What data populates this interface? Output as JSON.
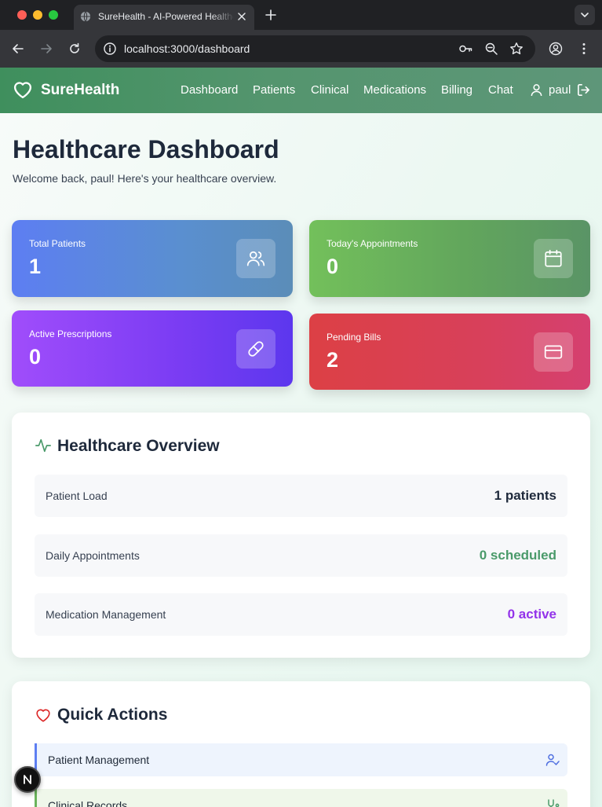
{
  "browser": {
    "tab_title": "SureHealth - AI-Powered Healthcare",
    "url": "localhost:3000/dashboard",
    "icons": [
      "globe-icon",
      "close-icon",
      "plus-icon",
      "chevron-down-icon",
      "back-icon",
      "forward-icon",
      "reload-icon",
      "site-info-icon",
      "key-icon",
      "zoom-icon",
      "star-icon",
      "profile-icon",
      "more-icon"
    ]
  },
  "header": {
    "brand": "SureHealth",
    "nav": [
      "Dashboard",
      "Patients",
      "Clinical",
      "Medications",
      "Billing",
      "Chat"
    ],
    "user": "paul"
  },
  "page": {
    "title": "Healthcare Dashboard",
    "subtitle": "Welcome back, paul! Here's your healthcare overview."
  },
  "stats": [
    {
      "label": "Total Patients",
      "value": "1",
      "icon": "users-icon",
      "color": "#5d7ef2"
    },
    {
      "label": "Today's Appointments",
      "value": "0",
      "icon": "calendar-icon",
      "color": "#6bb35c"
    },
    {
      "label": "Active Prescriptions",
      "value": "0",
      "icon": "pill-icon",
      "color": "#8b44f7"
    },
    {
      "label": "Pending Bills",
      "value": "2",
      "icon": "credit-card-icon",
      "color": "#d8405a"
    }
  ],
  "overview": {
    "title": "Healthcare Overview",
    "rows": [
      {
        "label": "Patient Load",
        "value": "1 patients",
        "color": "#1e293b"
      },
      {
        "label": "Daily Appointments",
        "value": "0 scheduled",
        "color": "#4a9a6a"
      },
      {
        "label": "Medication Management",
        "value": "0 active",
        "color": "#9333ea"
      }
    ]
  },
  "quick_actions": {
    "title": "Quick Actions",
    "items": [
      {
        "label": "Patient Management",
        "icon": "user-check-icon",
        "accent": "#5d7ef2"
      },
      {
        "label": "Clinical Records",
        "icon": "stethoscope-icon",
        "accent": "#6bb35c"
      }
    ]
  },
  "dev_badge": "N"
}
